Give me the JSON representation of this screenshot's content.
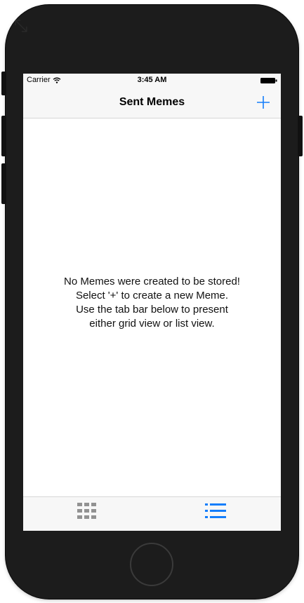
{
  "status_bar": {
    "carrier": "Carrier",
    "time": "3:45 AM",
    "icons": [
      "wifi-icon",
      "battery-icon"
    ]
  },
  "nav_bar": {
    "title": "Sent Memes",
    "add_button_icon": "plus-icon"
  },
  "content": {
    "empty_message_lines": [
      "No Memes were created to be stored!",
      "Select '+' to create a new Meme.",
      "Use the tab bar below to present",
      "either grid view or list view."
    ]
  },
  "tab_bar": {
    "tabs": [
      {
        "icon": "grid-icon",
        "selected": false
      },
      {
        "icon": "list-icon",
        "selected": true
      }
    ]
  },
  "colors": {
    "accent": "#147efb",
    "inactive_tab": "#929292",
    "device_body": "#1c1c1c",
    "bar_background": "#f7f7f7"
  }
}
